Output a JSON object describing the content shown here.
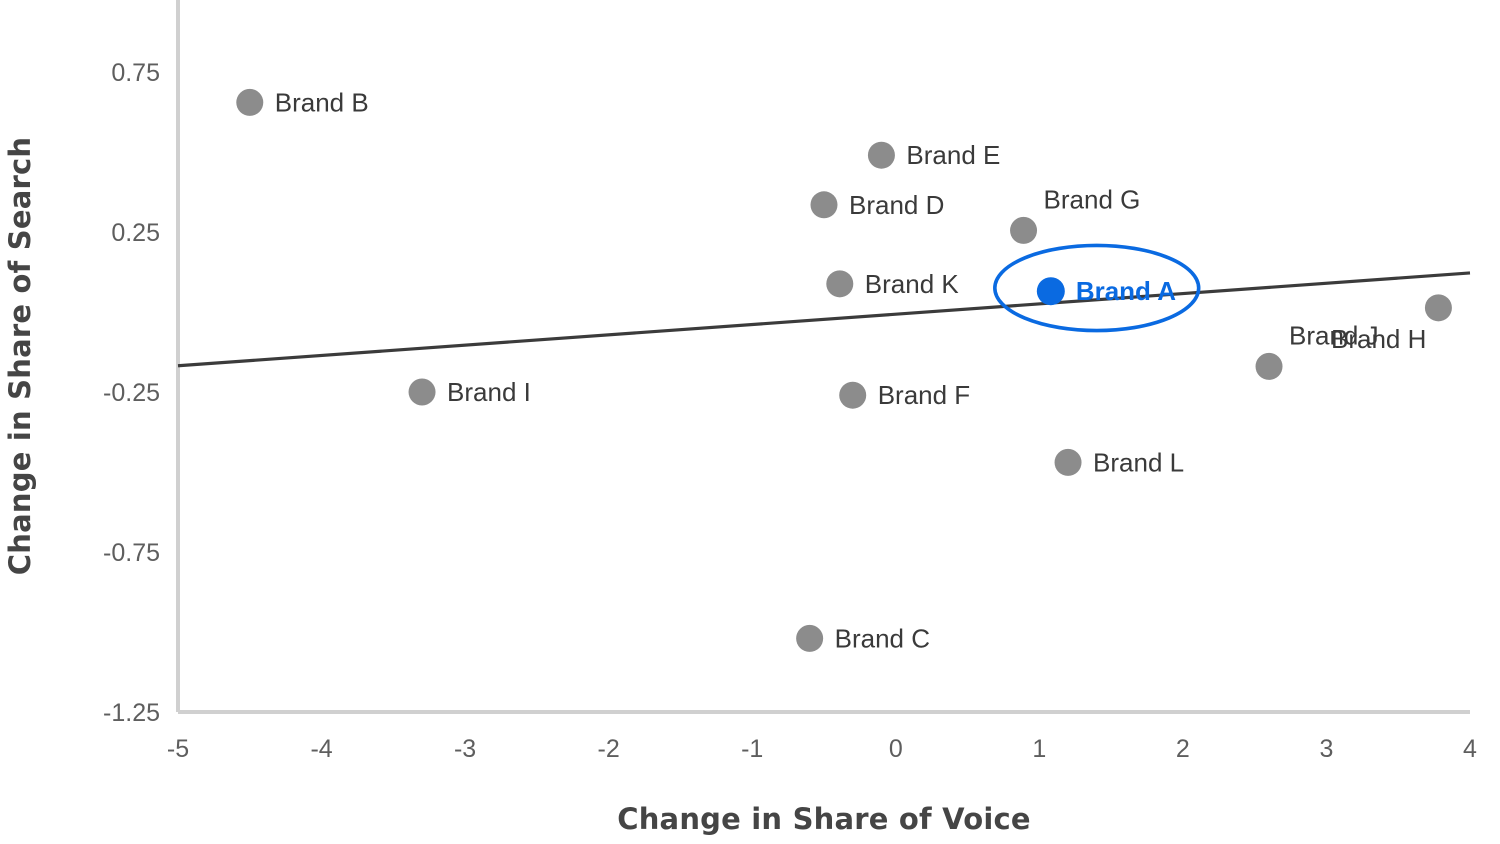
{
  "chart_data": {
    "type": "scatter",
    "title": "",
    "xlabel": "Change in Share of Voice",
    "ylabel": "Change in Share of Search",
    "xlim": [
      -5,
      4
    ],
    "ylim": [
      -1.25,
      0.75
    ],
    "xticks": [
      "-5",
      "-4",
      "-3",
      "-2",
      "-1",
      "0",
      "1",
      "2",
      "3",
      "4"
    ],
    "xtick_values": [
      -5,
      -4,
      -3,
      -2,
      -1,
      0,
      1,
      2,
      3,
      4
    ],
    "yticks": [
      "0.75",
      "0.25",
      "-0.25",
      "-0.75",
      "-1.25"
    ],
    "ytick_values": [
      0.75,
      0.25,
      -0.25,
      -0.75,
      -1.25
    ],
    "grid": false,
    "legend": "none",
    "marker_color": "#8c8c8c",
    "highlight_color": "#0a6ae1",
    "trendline_color": "#3b3b3b",
    "axis_color": "#d0d0d0",
    "points": [
      {
        "label": "Brand B",
        "x": -4.5,
        "y": 0.655,
        "highlight": false,
        "label_pos": "right"
      },
      {
        "label": "Brand E",
        "x": -0.1,
        "y": 0.49,
        "highlight": false,
        "label_pos": "right"
      },
      {
        "label": "Brand D",
        "x": -0.5,
        "y": 0.335,
        "highlight": false,
        "label_pos": "right"
      },
      {
        "label": "Brand G",
        "x": 0.89,
        "y": 0.255,
        "highlight": false,
        "label_pos": "above-right"
      },
      {
        "label": "Brand K",
        "x": -0.39,
        "y": 0.088,
        "highlight": false,
        "label_pos": "right"
      },
      {
        "label": "Brand A",
        "x": 1.08,
        "y": 0.065,
        "highlight": true,
        "label_pos": "right"
      },
      {
        "label": "Brand H",
        "x": 3.78,
        "y": 0.013,
        "highlight": false,
        "label_pos": "below-left"
      },
      {
        "label": "Brand J",
        "x": 2.6,
        "y": -0.17,
        "highlight": false,
        "label_pos": "above-right"
      },
      {
        "label": "Brand I",
        "x": -3.3,
        "y": -0.25,
        "highlight": false,
        "label_pos": "right"
      },
      {
        "label": "Brand F",
        "x": -0.3,
        "y": -0.26,
        "highlight": false,
        "label_pos": "right"
      },
      {
        "label": "Brand L",
        "x": 1.2,
        "y": -0.47,
        "highlight": false,
        "label_pos": "right"
      },
      {
        "label": "Brand C",
        "x": -0.6,
        "y": -1.02,
        "highlight": false,
        "label_pos": "right"
      }
    ],
    "trendline": {
      "x_start": -5.0,
      "y_start": -0.168,
      "x_end": 4.0,
      "y_end": 0.122
    },
    "highlight_annotation": {
      "label": "Brand A",
      "shape": "ellipse",
      "center_x": 1.4,
      "center_y": 0.075,
      "radius_x": 0.71,
      "radius_y": 0.133
    }
  }
}
